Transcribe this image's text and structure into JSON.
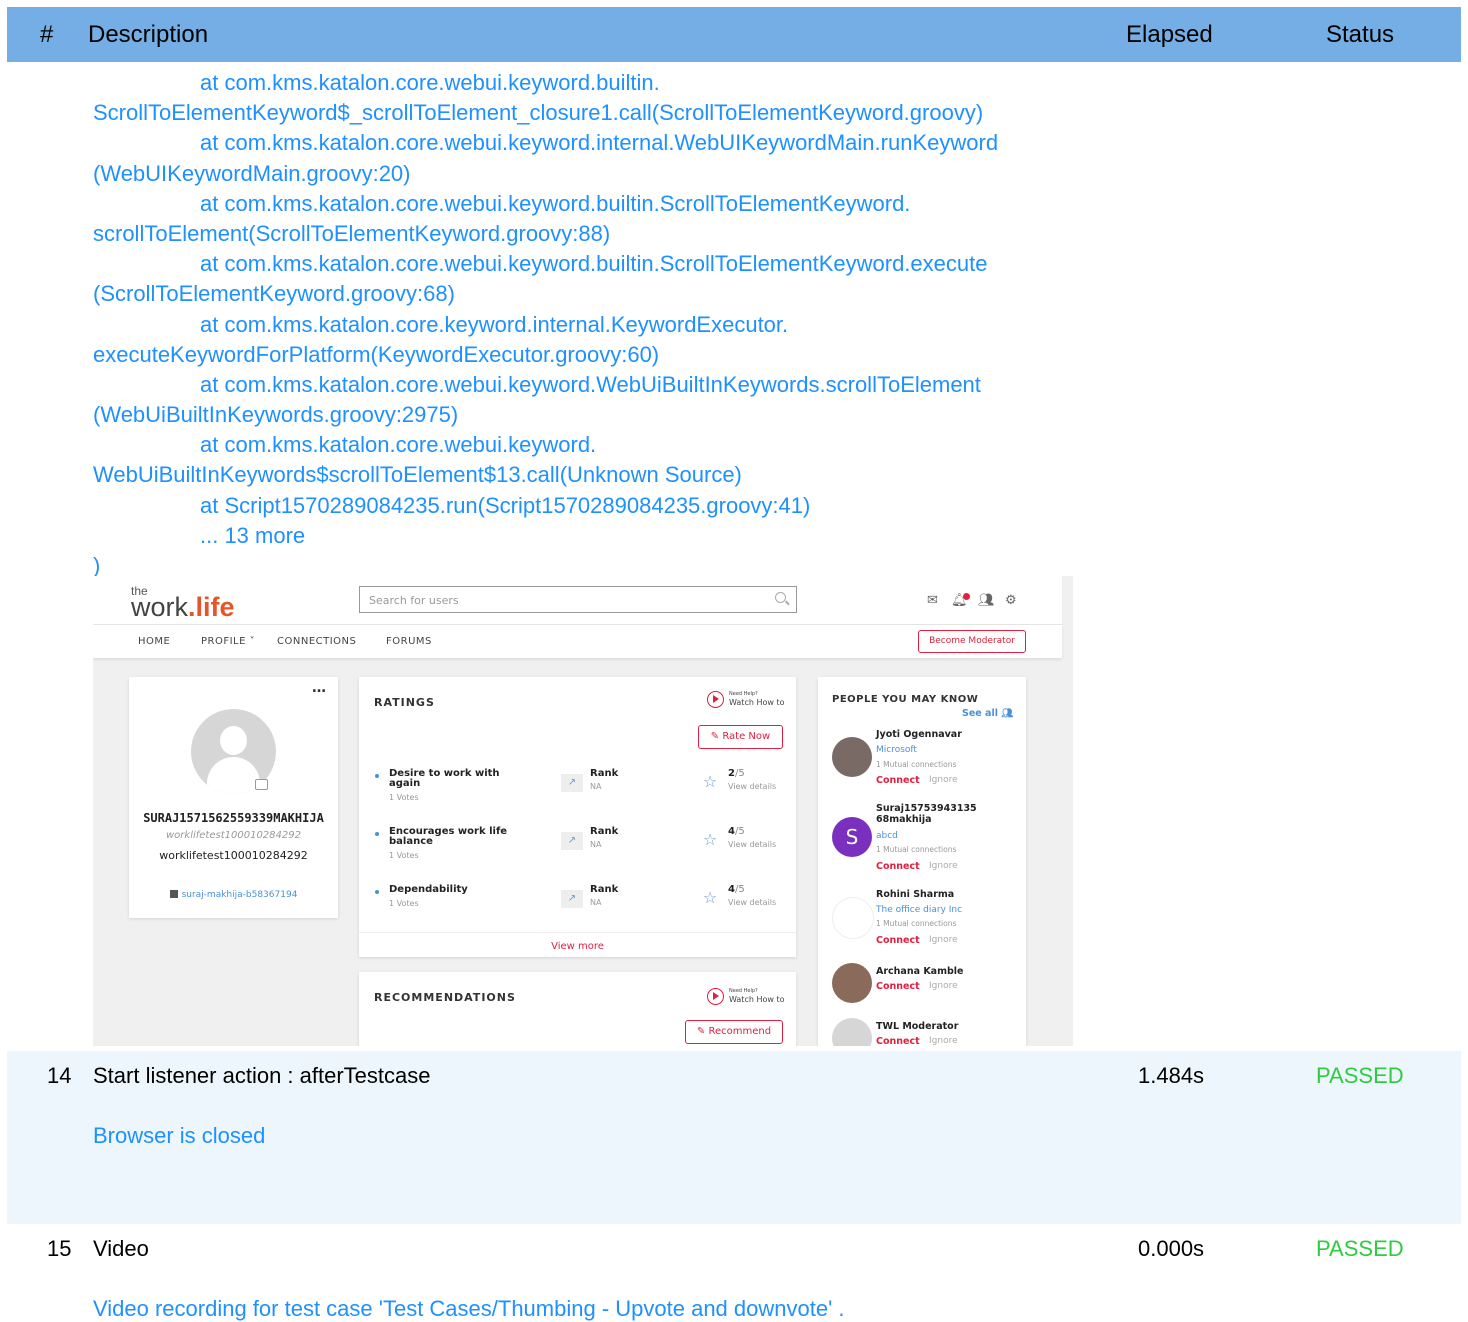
{
  "table": {
    "header": {
      "num": "#",
      "description": "Description",
      "elapsed": "Elapsed",
      "status": "Status"
    },
    "trace_lines": [
      "at com.kms.katalon.core.webui.keyword.builtin.",
      "ScrollToElementKeyword$_scrollToElement_closure1.call(ScrollToElementKeyword.groovy)",
      "at com.kms.katalon.core.webui.keyword.internal.WebUIKeywordMain.runKeyword",
      "(WebUIKeywordMain.groovy:20)",
      "at com.kms.katalon.core.webui.keyword.builtin.ScrollToElementKeyword.",
      "scrollToElement(ScrollToElementKeyword.groovy:88)",
      "at com.kms.katalon.core.webui.keyword.builtin.ScrollToElementKeyword.execute",
      "(ScrollToElementKeyword.groovy:68)",
      "at com.kms.katalon.core.keyword.internal.KeywordExecutor.",
      "executeKeywordForPlatform(KeywordExecutor.groovy:60)",
      "at com.kms.katalon.core.webui.keyword.WebUiBuiltInKeywords.scrollToElement",
      "(WebUiBuiltInKeywords.groovy:2975)",
      "at com.kms.katalon.core.webui.keyword.",
      "WebUiBuiltInKeywords$scrollToElement$13.call(Unknown Source)",
      "at Script1570289084235.run(Script1570289084235.groovy:41)",
      "... 13 more",
      ")"
    ],
    "rows": [
      {
        "num": "14",
        "description": "Start listener action : afterTestcase",
        "elapsed": "1.484s",
        "status": "PASSED",
        "message": "Browser is closed"
      },
      {
        "num": "15",
        "description": "Video",
        "elapsed": "0.000s",
        "status": "PASSED",
        "message": "Video recording for test case 'Test Cases/Thumbing - Upvote and downvote' ."
      }
    ]
  },
  "screenshot": {
    "logo": {
      "the": "the",
      "work": "work",
      "life": "life"
    },
    "search_placeholder": "Search for users",
    "nav": [
      "HOME",
      "PROFILE ˅",
      "CONNECTIONS",
      "FORUMS"
    ],
    "become_moderator": "Become Moderator",
    "profile": {
      "menu": "…",
      "name": "SURAJ1571562559339MAKHIJA",
      "username": "worklifetest100010284292",
      "email": "worklifetest100010284292",
      "linkedin": "suraj-makhija-b58367194"
    },
    "help": {
      "line1": "Need Help?",
      "line2": "Watch How to"
    },
    "ratings": {
      "title": "RATINGS",
      "rate_now": "✎ Rate Now",
      "items": [
        {
          "label": "Desire to work with again",
          "votes": "1 Votes",
          "rank": "Rank",
          "rank_value": "NA",
          "score": "2",
          "out_of": "/5",
          "details": "View details"
        },
        {
          "label": "Encourages work life balance",
          "votes": "1 Votes",
          "rank": "Rank",
          "rank_value": "NA",
          "score": "4",
          "out_of": "/5",
          "details": "View details"
        },
        {
          "label": "Dependability",
          "votes": "1 Votes",
          "rank": "Rank",
          "rank_value": "NA",
          "score": "4",
          "out_of": "/5",
          "details": "View details"
        }
      ],
      "view_more": "View more"
    },
    "recommendations": {
      "title": "RECOMMENDATIONS",
      "button": "✎ Recommend"
    },
    "people": {
      "title": "PEOPLE YOU MAY KNOW",
      "see_all": "See all",
      "connect": "Connect",
      "ignore": "Ignore",
      "list": [
        {
          "name": "Jyoti Ogennavar",
          "company": "Microsoft",
          "mutual": "1 Mutual connections"
        },
        {
          "name": "Suraj15753943135 68makhija",
          "initial": "S",
          "company": "abcd",
          "mutual": "1 Mutual connections"
        },
        {
          "name": "Rohini Sharma",
          "company": "The office diary Inc",
          "mutual": "1 Mutual connections"
        },
        {
          "name": "Archana Kamble"
        },
        {
          "name": "TWL Moderator"
        }
      ]
    },
    "colors": {
      "accent": "#e0203e",
      "link": "#4a90d9",
      "header": "#74aee4",
      "pass": "#2ecc40",
      "trace": "#1e90ff"
    }
  }
}
